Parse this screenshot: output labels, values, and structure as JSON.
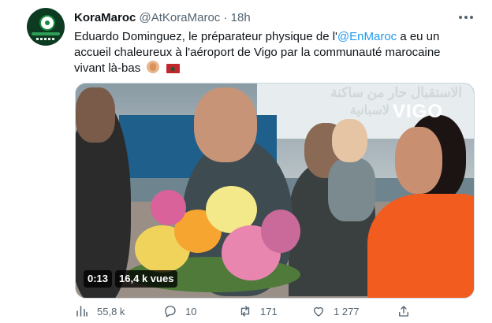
{
  "tweet": {
    "display_name": "KoraMaroc",
    "handle": "@AtKoraMaroc",
    "separator": "·",
    "time": "18h",
    "text_part1": "Eduardo Dominguez, le préparateur physique de l'",
    "mention": "@EnMaroc",
    "text_part2": " a eu un accueil chaleureux à l'aéroport de Vigo par la communauté marocaine vivant là-bas",
    "emojis": [
      "clapping-hands-emoji",
      "morocco-flag-emoji"
    ]
  },
  "media": {
    "type": "video",
    "duration": "0:13",
    "views": "16,4 k vues",
    "overlay_arabic_line1": "الاستقبال حار من ساكنة",
    "overlay_arabic_line2": "لاسبانية",
    "overlay_vigo": "VIGO"
  },
  "actions": {
    "views": "55,8 k",
    "replies": "10",
    "retweets": "171",
    "likes": "1 277"
  },
  "icons": {
    "views": "bar-chart-icon",
    "reply": "speech-bubble-icon",
    "retweet": "retweet-arrows-icon",
    "like": "heart-icon",
    "share": "share-upload-icon",
    "more": "more-dots-icon"
  },
  "colors": {
    "link": "#1d9bf0",
    "secondary_text": "#536471",
    "primary_text": "#0f1419"
  }
}
